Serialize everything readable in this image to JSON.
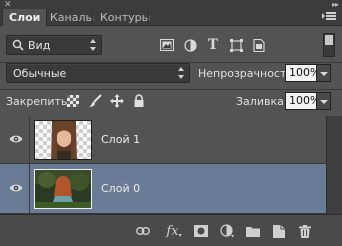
{
  "tabs": [
    {
      "label": "Слои",
      "active": true
    },
    {
      "label": "Каналы",
      "active": false
    },
    {
      "label": "Контуры",
      "active": false
    }
  ],
  "filter": {
    "label": "Вид",
    "icons": [
      "image-filter-icon",
      "adjustment-filter-icon",
      "type-filter-icon",
      "shape-filter-icon",
      "smart-object-filter-icon"
    ]
  },
  "blend": {
    "mode": "Обычные",
    "opacity_label": "Непрозрачность:",
    "opacity_value": "100%"
  },
  "lock": {
    "label": "Закрепить:",
    "fill_label": "Заливка:",
    "fill_value": "100%"
  },
  "layers": [
    {
      "name": "Слой 1",
      "selected": false,
      "visible": true
    },
    {
      "name": "Слой 0",
      "selected": true,
      "visible": true
    }
  ],
  "footer_icons": [
    "link-icon",
    "fx-icon",
    "mask-icon",
    "adjustment-icon",
    "folder-icon",
    "new-layer-icon",
    "trash-icon"
  ],
  "colors": {
    "panel": "#535353",
    "selected_layer": "#6a7b95",
    "tabbar": "#3c3c3c"
  }
}
